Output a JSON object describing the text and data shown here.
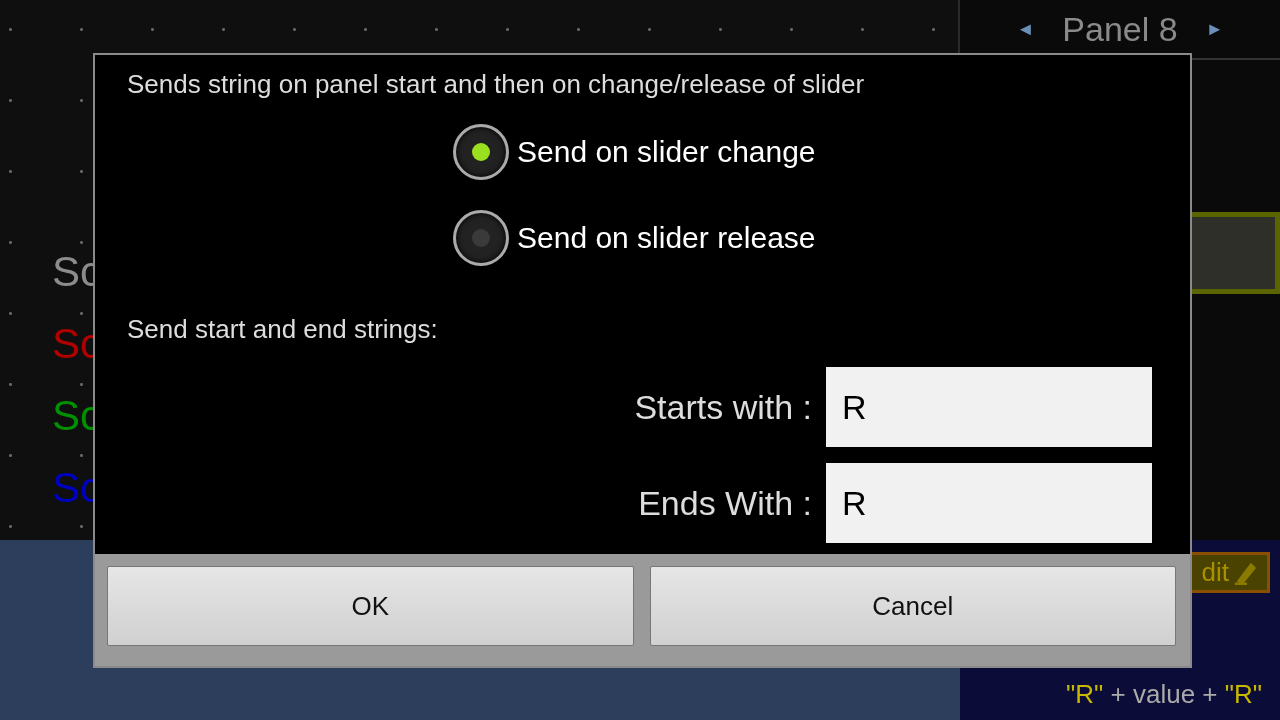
{
  "canvas_labels": [
    {
      "label": "Sc",
      "color": "#8c8c8c"
    },
    {
      "label": "Sc",
      "color": "#b00000"
    },
    {
      "label": "Sc",
      "color": "#009000"
    },
    {
      "label": "Sc",
      "color": "#0000c0"
    }
  ],
  "panel": {
    "title": "Panel 8",
    "prev": "◄",
    "next": "►"
  },
  "properties": {
    "edit_button": "dit",
    "sends": [
      {
        "text": "\"R\"",
        "kind": "literal"
      },
      {
        "text": " + value + ",
        "kind": "op"
      },
      {
        "text": "\"R\"",
        "kind": "literal"
      }
    ]
  },
  "dialog": {
    "message": "Sends string on panel start and then on change/release of slider",
    "options": [
      {
        "label": "Send on slider change",
        "selected": true
      },
      {
        "label": "Send on slider release",
        "selected": false
      }
    ],
    "section": "Send start and end strings:",
    "fields": [
      {
        "label": "Starts with :",
        "value": "R"
      },
      {
        "label": "Ends With :",
        "value": "R"
      }
    ],
    "buttons": [
      "OK",
      "Cancel"
    ]
  }
}
